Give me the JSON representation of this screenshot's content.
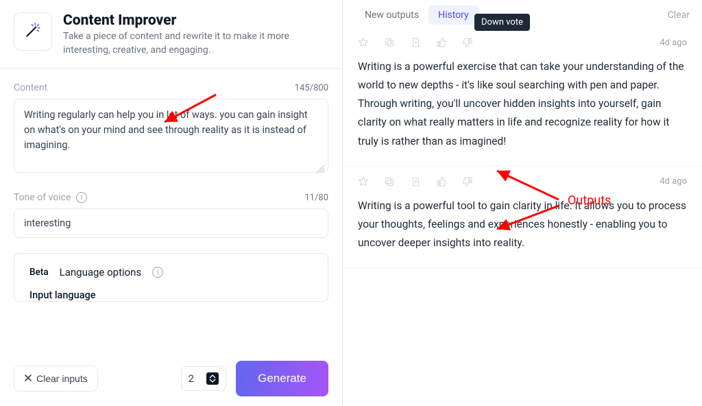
{
  "header": {
    "title": "Content Improver",
    "description": "Take a piece of content and rewrite it to make it more interesting, creative, and engaging."
  },
  "form": {
    "content_label": "Content",
    "content_count": "145/800",
    "content_value": "Writing regularly can help you in lot of ways. you can gain insight on what's on your mind and see through reality as it is instead of imagining.",
    "tone_label": "Tone of voice",
    "tone_count": "11/80",
    "tone_value": "interesting",
    "beta_label": "Beta",
    "language_options_label": "Language options",
    "input_language_label": "Input language"
  },
  "bottom": {
    "clear_label": "Clear inputs",
    "count_value": "2",
    "generate_label": "Generate"
  },
  "tabs": {
    "new_outputs": "New outputs",
    "history": "History",
    "clear": "Clear"
  },
  "tooltip": "Down vote",
  "outputs": [
    {
      "time": "4d ago",
      "text": "Writing is a powerful exercise that can take your understanding of the world to new depths - it's like soul searching with pen and paper. Through writing, you'll uncover hidden insights into yourself, gain clarity on what really matters in life and recognize reality for how it truly is rather than as imagined!"
    },
    {
      "time": "4d ago",
      "text": "Writing is a powerful tool to gain clarity in life. It allows you to process your thoughts, feelings and experiences honestly - enabling you to uncover deeper insights into reality."
    }
  ],
  "annotation": {
    "outputs_label": "Outputs"
  }
}
